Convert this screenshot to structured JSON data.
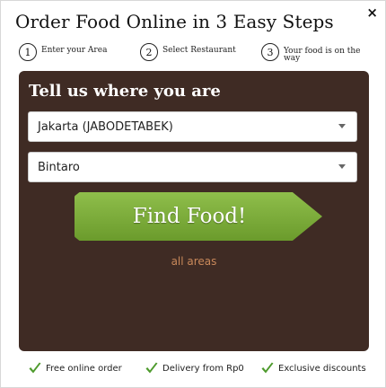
{
  "modal": {
    "title": "Order Food Online in 3 Easy Steps",
    "close_label": "×"
  },
  "steps": [
    {
      "number": "1",
      "label": "Enter your Area"
    },
    {
      "number": "2",
      "label": "Select Restaurant"
    },
    {
      "number": "3",
      "label": "Your food is on the way"
    }
  ],
  "panel": {
    "title": "Tell us where you are",
    "city_select": {
      "selected": "Jakarta (JABODETABEK)"
    },
    "area_select": {
      "selected": "Bintaro"
    },
    "find_button_label": "Find Food!",
    "all_areas_link": "all areas"
  },
  "features": [
    {
      "label": "Free online order",
      "icon": "checkmark-icon"
    },
    {
      "label": "Delivery from Rp0",
      "icon": "checkmark-icon"
    },
    {
      "label": "Exclusive discounts",
      "icon": "checkmark-icon"
    }
  ],
  "colors": {
    "panel_bg": "#3f2b24",
    "button_green": "#7aab36",
    "link_orange": "#c8885a",
    "check_green": "#4d9a2c"
  }
}
